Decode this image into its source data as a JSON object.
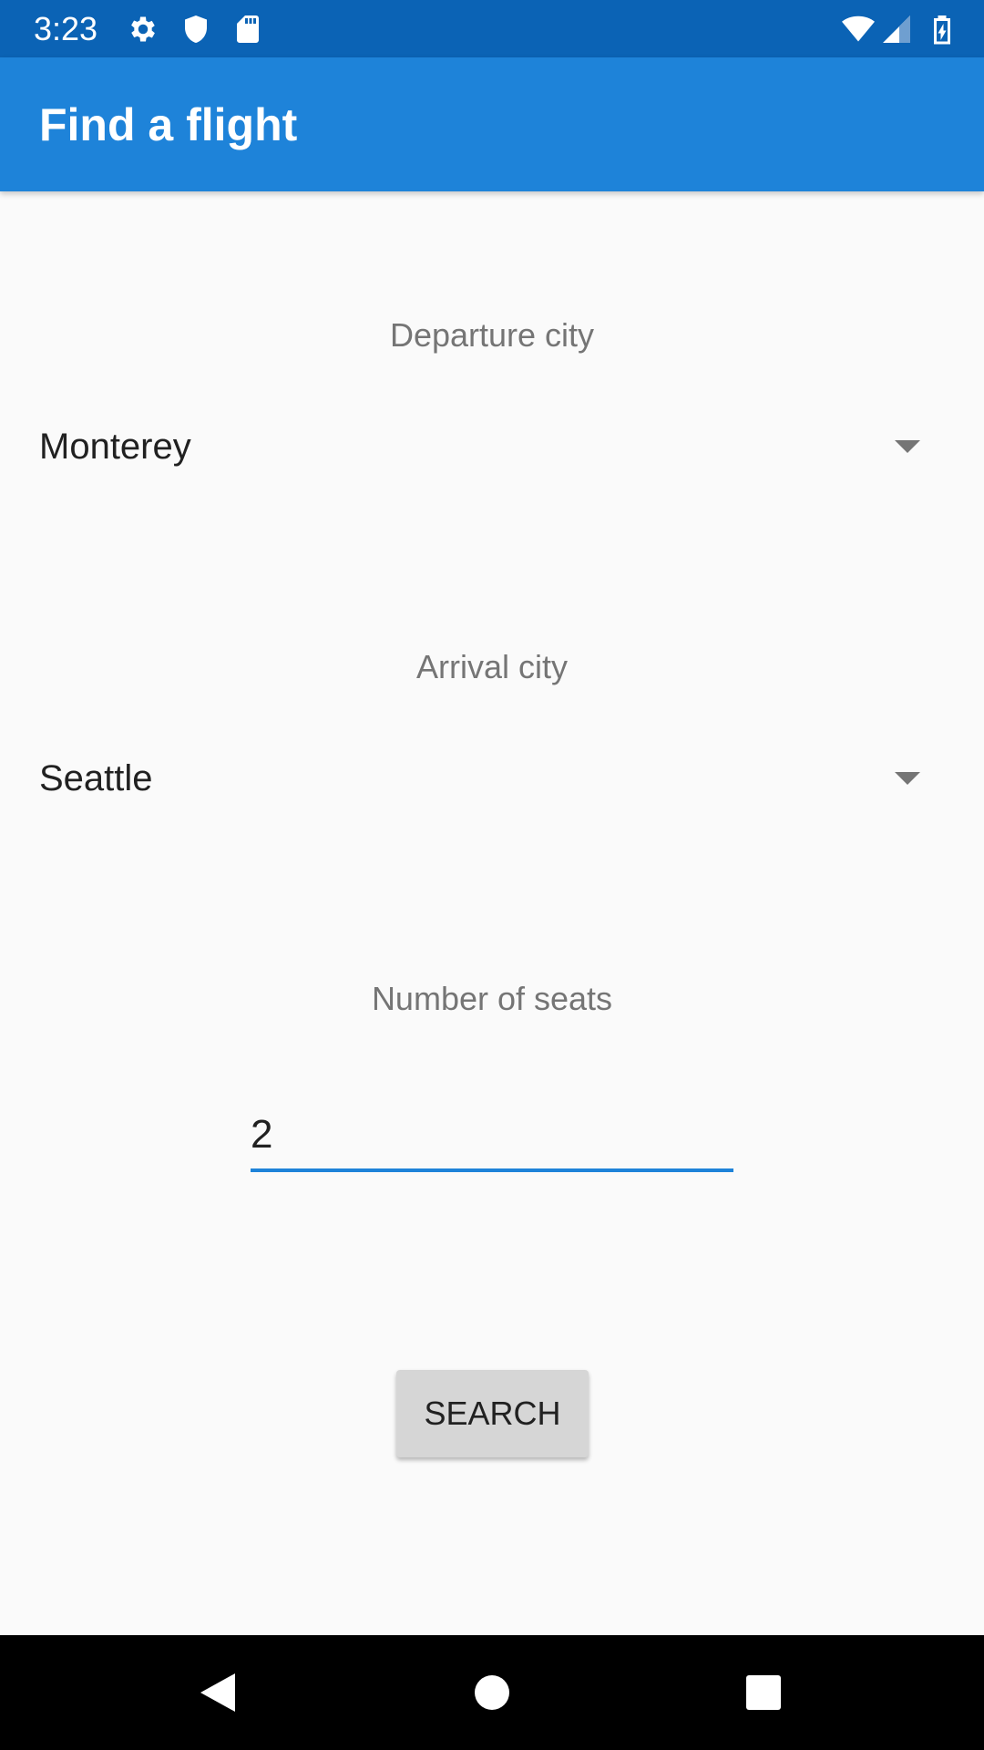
{
  "status_bar": {
    "time": "3:23",
    "left_icons": [
      "gear-icon",
      "shield-icon",
      "sd-card-icon"
    ],
    "right_icons": [
      "wifi-icon",
      "cell-signal-icon",
      "battery-charging-icon"
    ]
  },
  "app_bar": {
    "title": "Find a flight",
    "color": "#1e83d9"
  },
  "form": {
    "departure": {
      "label": "Departure city",
      "selected": "Monterey"
    },
    "arrival": {
      "label": "Arrival city",
      "selected": "Seattle"
    },
    "seats": {
      "label": "Number of seats",
      "value": "2"
    },
    "search_label": "SEARCH"
  },
  "nav_bar": {
    "buttons": [
      "back-icon",
      "home-icon",
      "recents-icon"
    ]
  }
}
